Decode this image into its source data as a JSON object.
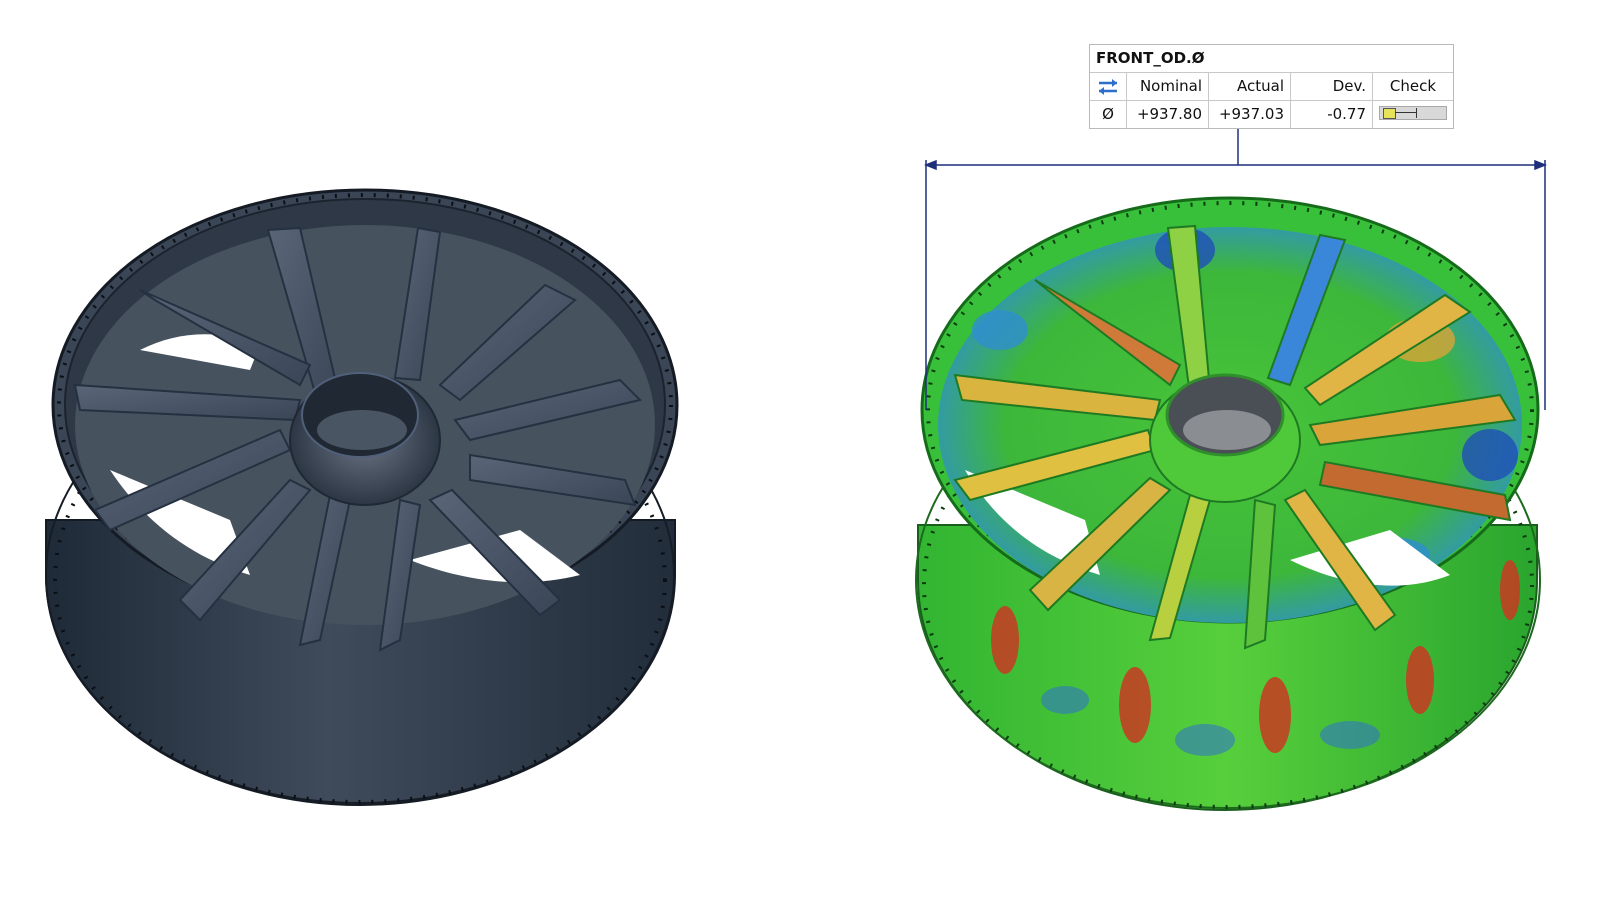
{
  "callout": {
    "title": "FRONT_OD.Ø",
    "headers": {
      "icon": "diameter-swap-icon",
      "nominal": "Nominal",
      "actual": "Actual",
      "dev": "Dev.",
      "check": "Check"
    },
    "row": {
      "symbol": "Ø",
      "nominal": "+937.80",
      "actual": "+937.03",
      "dev": "-0.77"
    }
  },
  "colors": {
    "cad_model": "#3b4757",
    "leader_line": "#1f2f7a",
    "map_green": "#3fc23a",
    "map_yellow": "#e3d640",
    "map_red": "#c93a22",
    "map_blue": "#1f4fb8",
    "check_fill": "#e6e35a"
  }
}
